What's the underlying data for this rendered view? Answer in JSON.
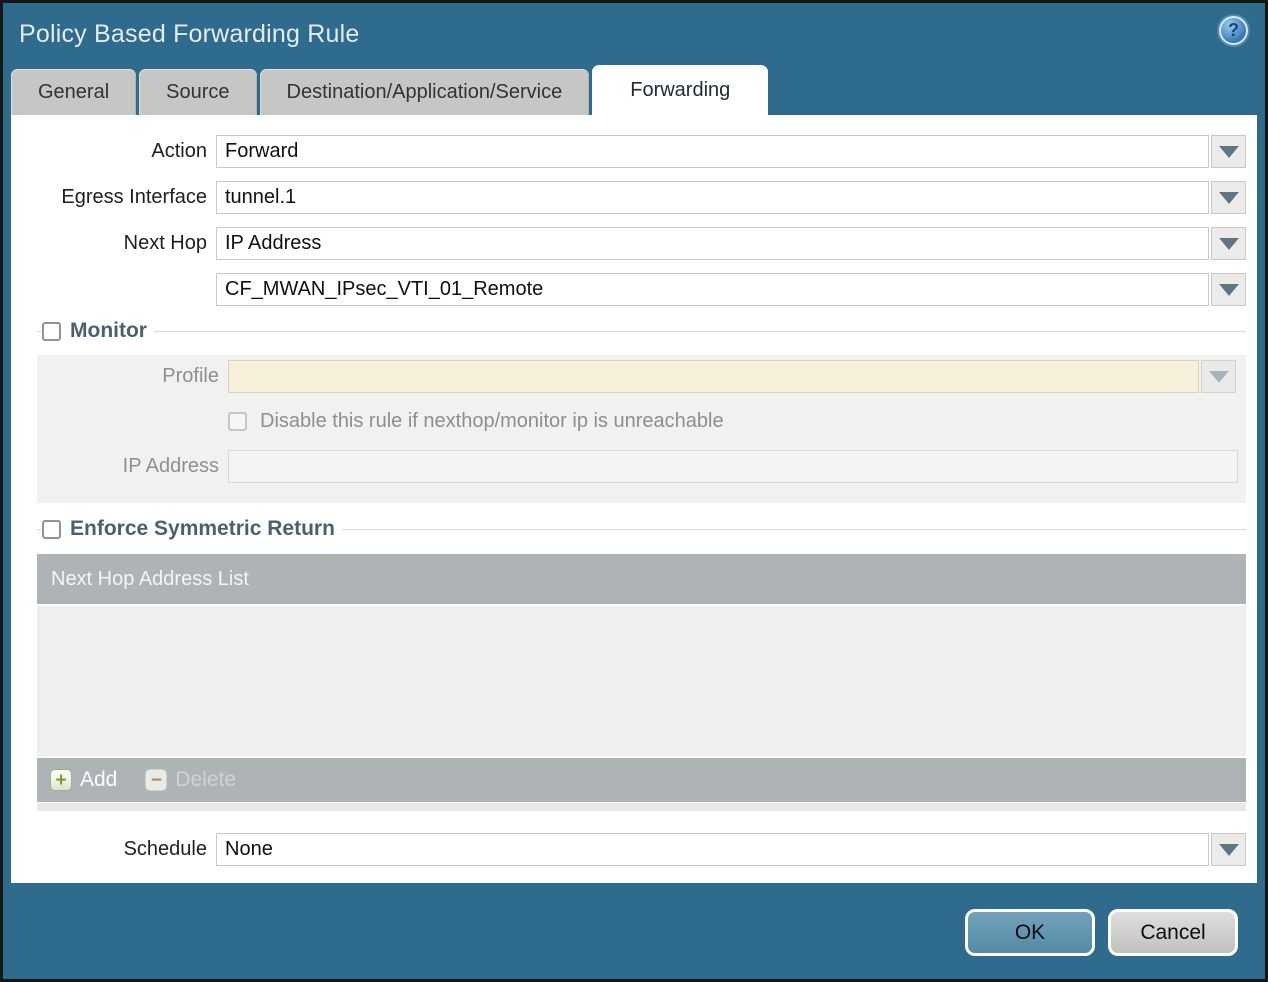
{
  "window": {
    "title": "Policy Based Forwarding Rule"
  },
  "icons": {
    "help_glyph": "?",
    "add_glyph": "+",
    "delete_glyph": "−"
  },
  "tabs": [
    {
      "label": "General",
      "active": false
    },
    {
      "label": "Source",
      "active": false
    },
    {
      "label": "Destination/Application/Service",
      "active": false
    },
    {
      "label": "Forwarding",
      "active": true
    }
  ],
  "form": {
    "action": {
      "label": "Action",
      "value": "Forward"
    },
    "egress_interface": {
      "label": "Egress Interface",
      "value": "tunnel.1"
    },
    "next_hop": {
      "label": "Next Hop",
      "value": "IP Address"
    },
    "next_hop_address": {
      "value": "CF_MWAN_IPsec_VTI_01_Remote"
    },
    "monitor": {
      "label": "Monitor",
      "checked": false,
      "profile": {
        "label": "Profile",
        "value": ""
      },
      "disable_rule": {
        "label": "Disable this rule if nexthop/monitor ip is unreachable",
        "checked": false
      },
      "ip_address": {
        "label": "IP Address",
        "value": ""
      }
    },
    "enforce_symmetric_return": {
      "label": "Enforce Symmetric Return",
      "checked": false,
      "next_hop_list": {
        "header": "Next Hop Address List",
        "rows": [],
        "add_label": "Add",
        "delete_label": "Delete",
        "delete_enabled": false
      }
    },
    "schedule": {
      "label": "Schedule",
      "value": "None"
    }
  },
  "footer": {
    "ok_label": "OK",
    "cancel_label": "Cancel"
  },
  "colors": {
    "titlebar_teal": "#2e6b8c",
    "active_tab_bg": "#ffffff",
    "inactive_tab_bg": "#c6c6c6",
    "section_label": "#4d5f6e",
    "disabled_field_beige": "#f6efda",
    "table_header_gray": "#aeb4b6",
    "ok_button_teal": "#5b92ae",
    "add_icon_green": "#7c9c28",
    "delete_icon_red": "#b5826e",
    "help_icon_blue": "#2f74ad"
  }
}
